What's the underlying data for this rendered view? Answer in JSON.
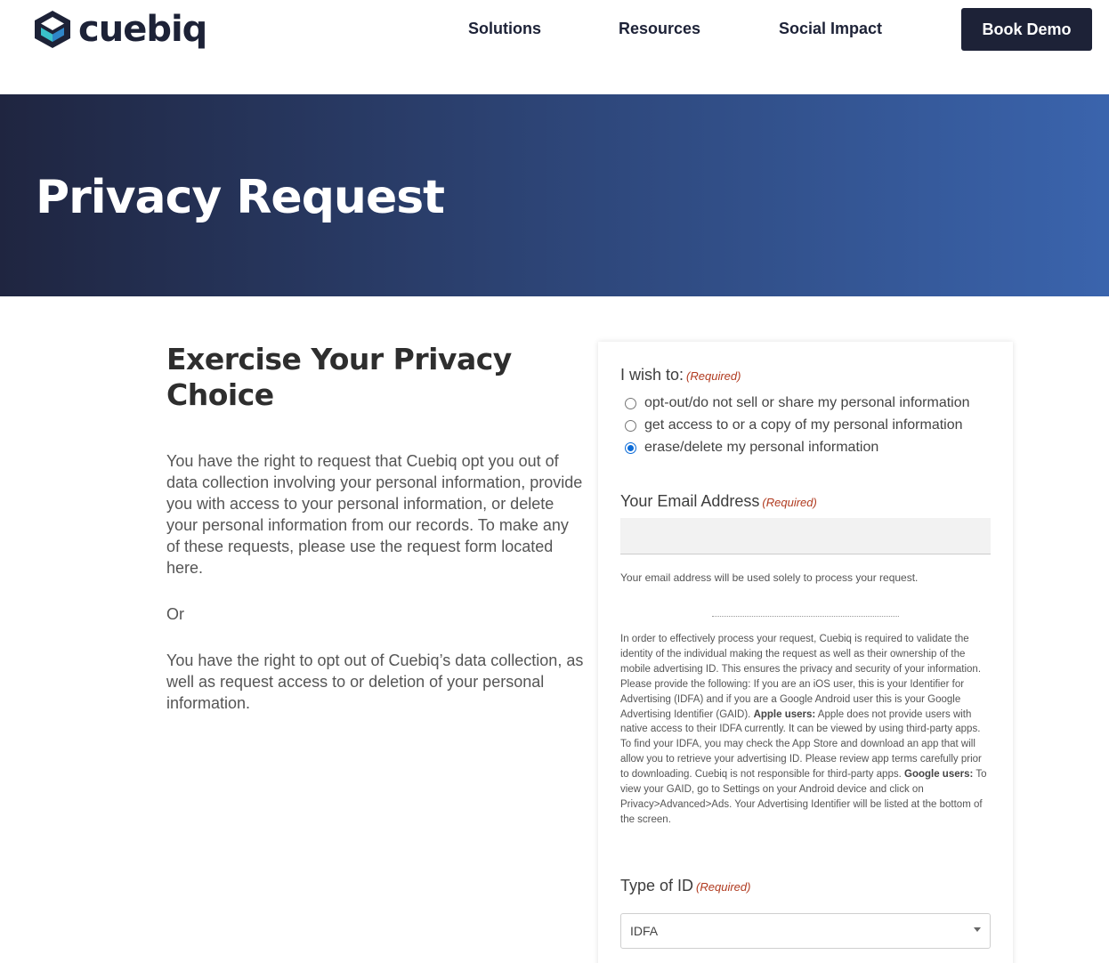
{
  "header": {
    "logo_text": "cuebiq",
    "nav": [
      "Solutions",
      "Resources",
      "Social Impact"
    ],
    "cta_label": "Book Demo"
  },
  "hero": {
    "title": "Privacy Request"
  },
  "left": {
    "title_line1": "Exercise Your Privacy",
    "title_line2": "Choice",
    "para1": "You have the right to request that Cuebiq opt you out of data collection involving your personal information, provide you with access to your personal information, or delete your personal information from our records. To make any of these requests, please use the request form located here.",
    "or": "Or",
    "para2": "You have the right to opt out of Cuebiq’s data collection, as well as request access to or deletion of your personal information."
  },
  "form": {
    "required_text": "(Required)",
    "wish_label": "I wish to:",
    "options": [
      {
        "label": "opt-out/do not sell or share my personal information",
        "checked": false
      },
      {
        "label": "get access to or a copy of my personal information",
        "checked": false
      },
      {
        "label": "erase/delete my personal information",
        "checked": true
      }
    ],
    "email_label": "Your Email Address",
    "email_value": "",
    "email_help": "Your email address will be used solely to process your request.",
    "info_intro": "In order to effectively process your request, Cuebiq is required to validate the identity of the individual making the request as well as their ownership of the mobile advertising ID. This ensures the privacy and security of your information. Please provide the following: If you are an iOS user, this is your Identifier for Advertising (IDFA) and if you are a Google Android user this is your Google Advertising Identifier (GAID).",
    "apple_heading": "Apple users:",
    "apple_text": " Apple does not provide users with native access to their IDFA currently. It can be viewed by using third-party apps. To find your IDFA, you may check the App Store and download an app that will allow you to retrieve your advertising ID. Please review app terms carefully prior to downloading. Cuebiq is not responsible for third-party apps.",
    "google_heading": "Google users:",
    "google_text": " To view your GAID, go to Settings on your Android device and click on Privacy>Advanced>Ads. Your Advertising Identifier will be listed at the bottom of the screen.",
    "type_label": "Type of ID",
    "type_value": "IDFA"
  },
  "colors": {
    "navy": "#1d2237",
    "hero_start": "#1f2540",
    "hero_end": "#3a64ad",
    "required": "#b03a1f",
    "radio_checked": "#0b6bd8"
  }
}
